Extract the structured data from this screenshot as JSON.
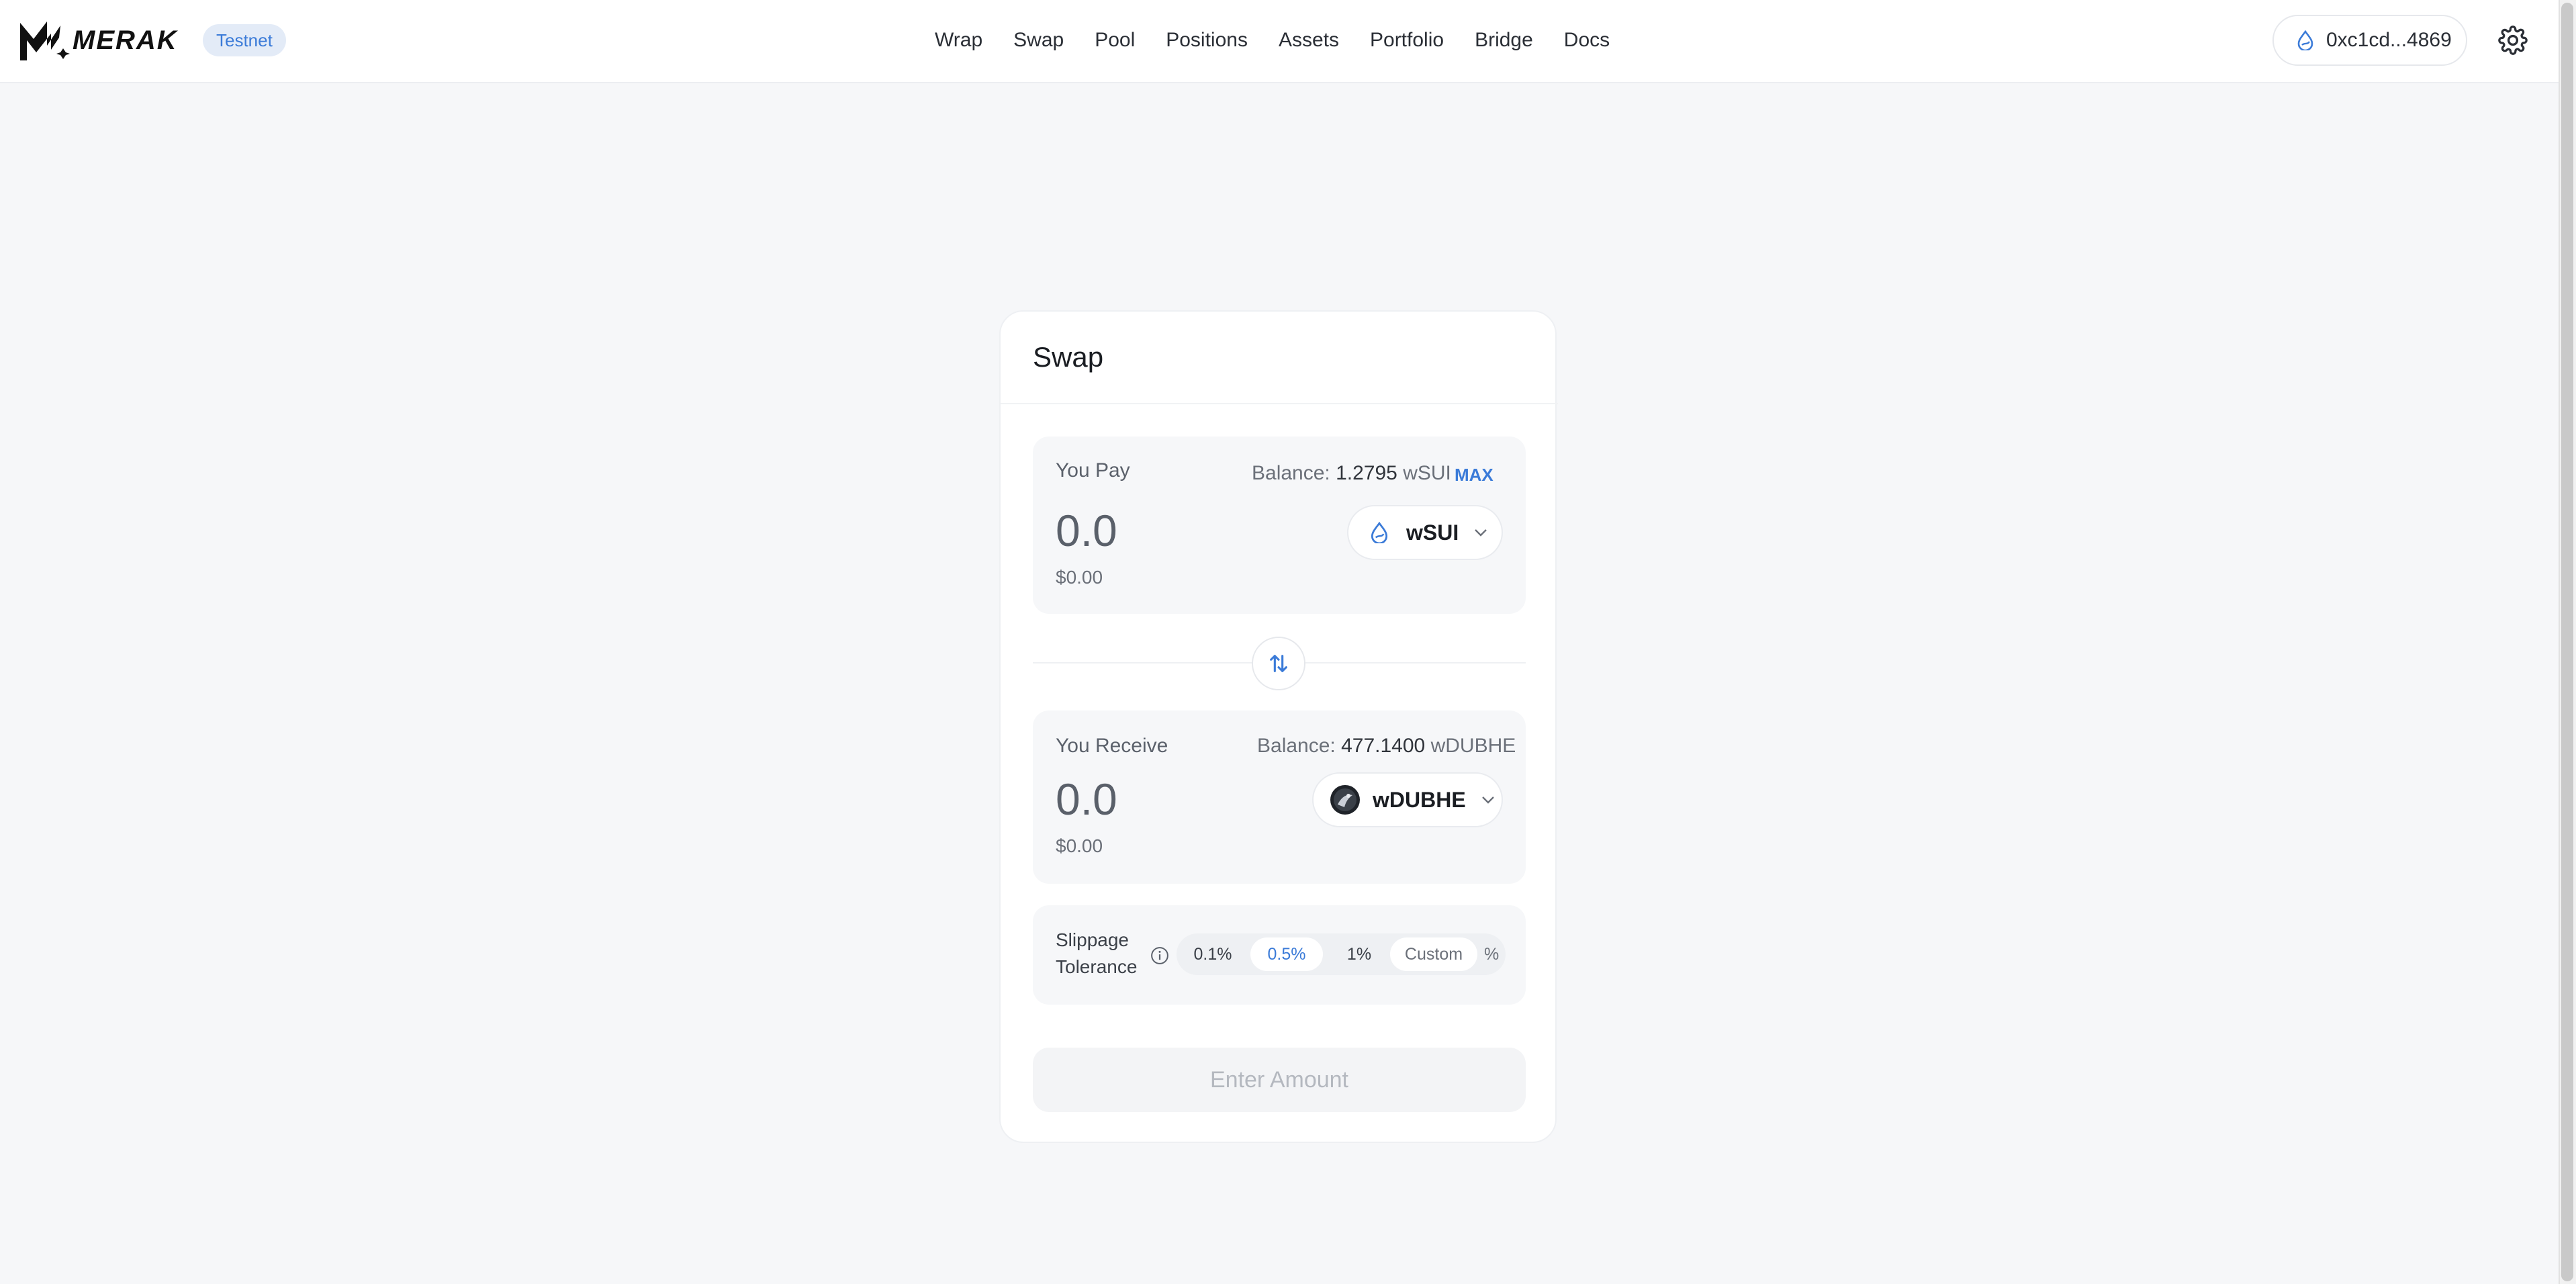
{
  "header": {
    "logo_text": "MERAK",
    "network_badge": "Testnet",
    "nav": [
      "Wrap",
      "Swap",
      "Pool",
      "Positions",
      "Assets",
      "Portfolio",
      "Bridge",
      "Docs"
    ],
    "wallet_address": "0xc1cd...4869",
    "icons": {
      "wallet": "sui-drop-icon",
      "settings": "gear-icon"
    }
  },
  "swap": {
    "title": "Swap",
    "pay": {
      "label": "You Pay",
      "balance_prefix": "Balance:",
      "balance_value": "1.2795",
      "balance_token": "wSUI",
      "max_label": "MAX",
      "amount": "0.0",
      "usd": "$0.00",
      "token": "wSUI"
    },
    "receive": {
      "label": "You Receive",
      "balance_prefix": "Balance:",
      "balance_value": "477.1400",
      "balance_token": "wDUBHE",
      "amount": "0.0",
      "usd": "$0.00",
      "token": "wDUBHE"
    },
    "slippage": {
      "label_line1": "Slippage",
      "label_line2": "Tolerance",
      "options": [
        "0.1%",
        "0.5%",
        "1%"
      ],
      "selected": "0.5%",
      "custom_placeholder": "Custom",
      "percent_sign": "%"
    },
    "submit_label": "Enter Amount"
  },
  "colors": {
    "accent": "#3b7bd8",
    "background": "#f6f7f9",
    "card": "#ffffff"
  }
}
